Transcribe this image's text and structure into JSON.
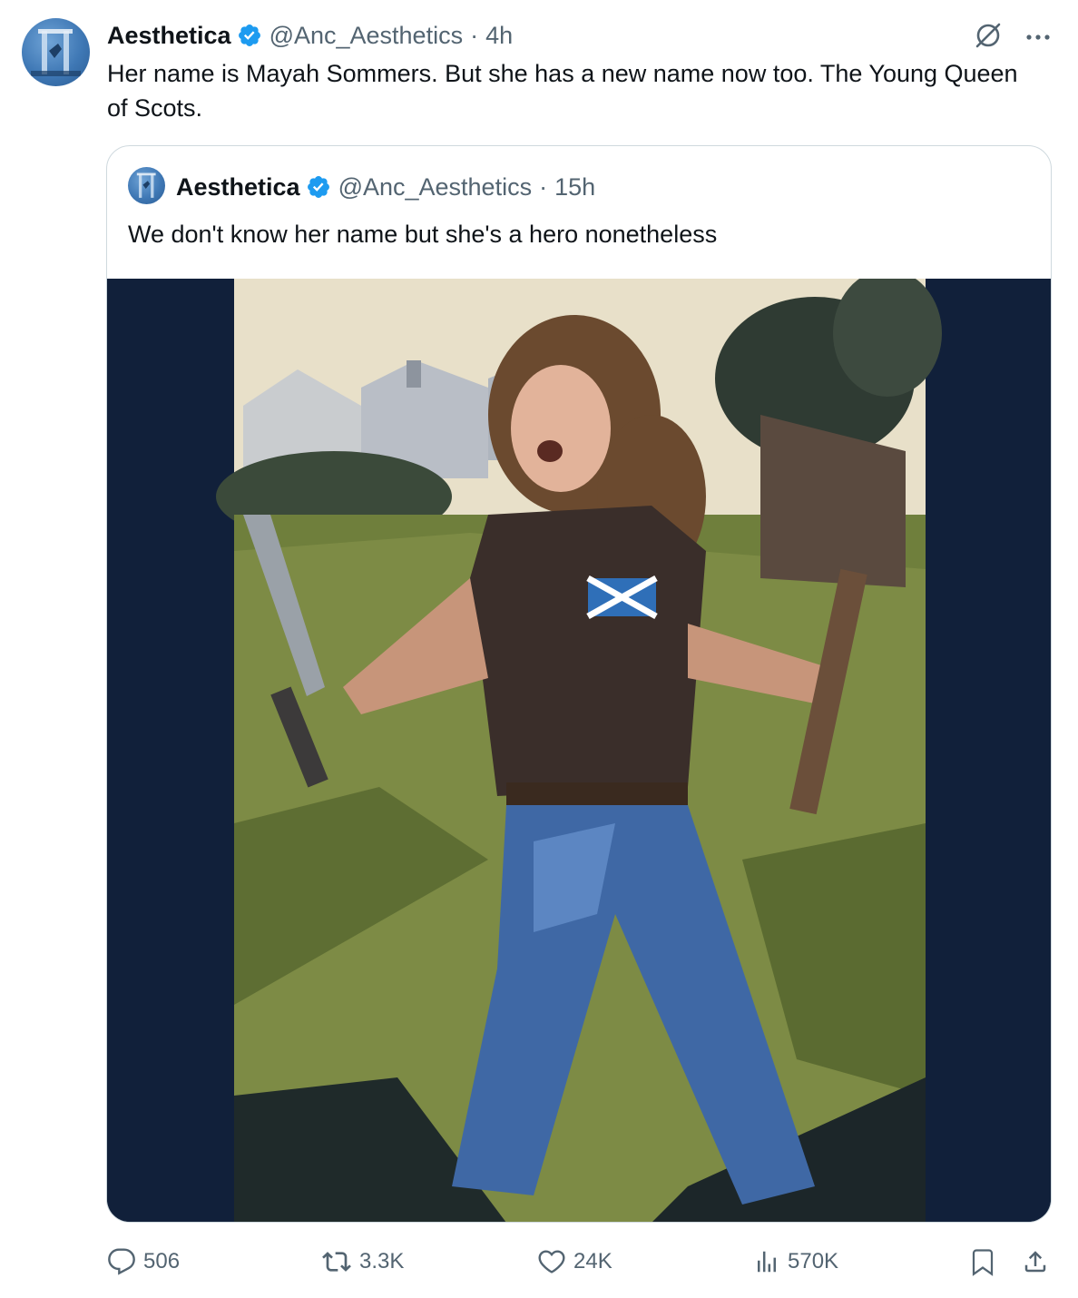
{
  "tweet": {
    "author_name": "Aesthetica",
    "handle": "@Anc_Aesthetics",
    "separator": "·",
    "time": "4h",
    "text": "Her name is Mayah Sommers. But she has a new name now too. The Young Queen of Scots.",
    "icons": [
      "grok-icon",
      "more-icon",
      "verified-badge-icon"
    ]
  },
  "quoted_tweet": {
    "author_name": "Aesthetica",
    "handle": "@Anc_Aesthetics",
    "separator": "·",
    "time": "15h",
    "text": "We don't know her name but she's a hero nonetheless",
    "media_description_visible": false
  },
  "actions": {
    "replies": "506",
    "reposts": "3.3K",
    "likes": "24K",
    "views": "570K",
    "icons": [
      "reply-icon",
      "repost-icon",
      "like-icon",
      "views-icon",
      "bookmark-icon",
      "share-icon"
    ]
  },
  "colors": {
    "text_primary": "#0f1419",
    "text_secondary": "#536471",
    "verified_blue": "#1d9bf0",
    "border": "#cfd9de",
    "media_letterbox": "#11203a"
  }
}
